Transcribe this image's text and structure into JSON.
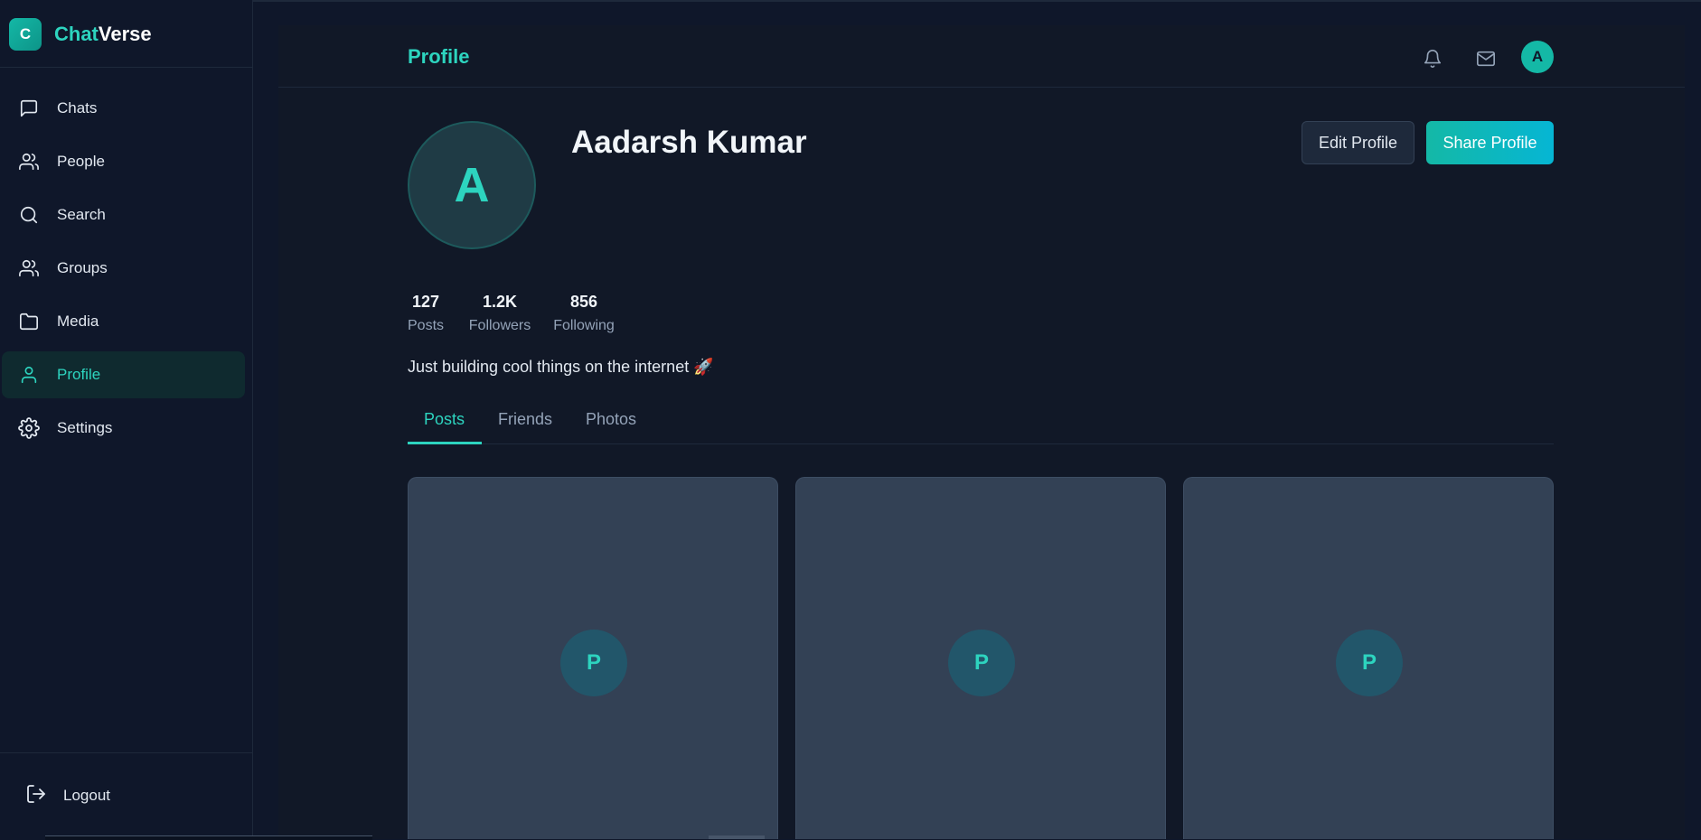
{
  "app": {
    "logo_letter": "C",
    "name_part1": "Chat",
    "name_part2": "Verse"
  },
  "sidebar": {
    "items": [
      {
        "label": "Chats",
        "icon": "message-square-icon"
      },
      {
        "label": "People",
        "icon": "users-icon"
      },
      {
        "label": "Search",
        "icon": "search-icon"
      },
      {
        "label": "Groups",
        "icon": "users-icon"
      },
      {
        "label": "Media",
        "icon": "folder-icon"
      },
      {
        "label": "Profile",
        "icon": "user-icon",
        "active": true
      },
      {
        "label": "Settings",
        "icon": "gear-icon"
      }
    ],
    "logout_label": "Logout"
  },
  "header": {
    "title": "Profile",
    "avatar_letter": "A"
  },
  "profile": {
    "avatar_letter": "A",
    "name": "Aadarsh Kumar",
    "edit_label": "Edit Profile",
    "share_label": "Share Profile",
    "stats": [
      {
        "value": "127",
        "label": "Posts"
      },
      {
        "value": "1.2K",
        "label": "Followers"
      },
      {
        "value": "856",
        "label": "Following"
      }
    ],
    "bio": "Just building cool things on the internet 🚀"
  },
  "tabs": [
    {
      "label": "Posts",
      "active": true
    },
    {
      "label": "Friends"
    },
    {
      "label": "Photos"
    }
  ],
  "posts": [
    {
      "placeholder": "P"
    },
    {
      "placeholder": "P"
    },
    {
      "placeholder": "P"
    }
  ],
  "colors": {
    "accent": "#2dd4bf",
    "background": "#0f172a",
    "card": "#334155"
  }
}
